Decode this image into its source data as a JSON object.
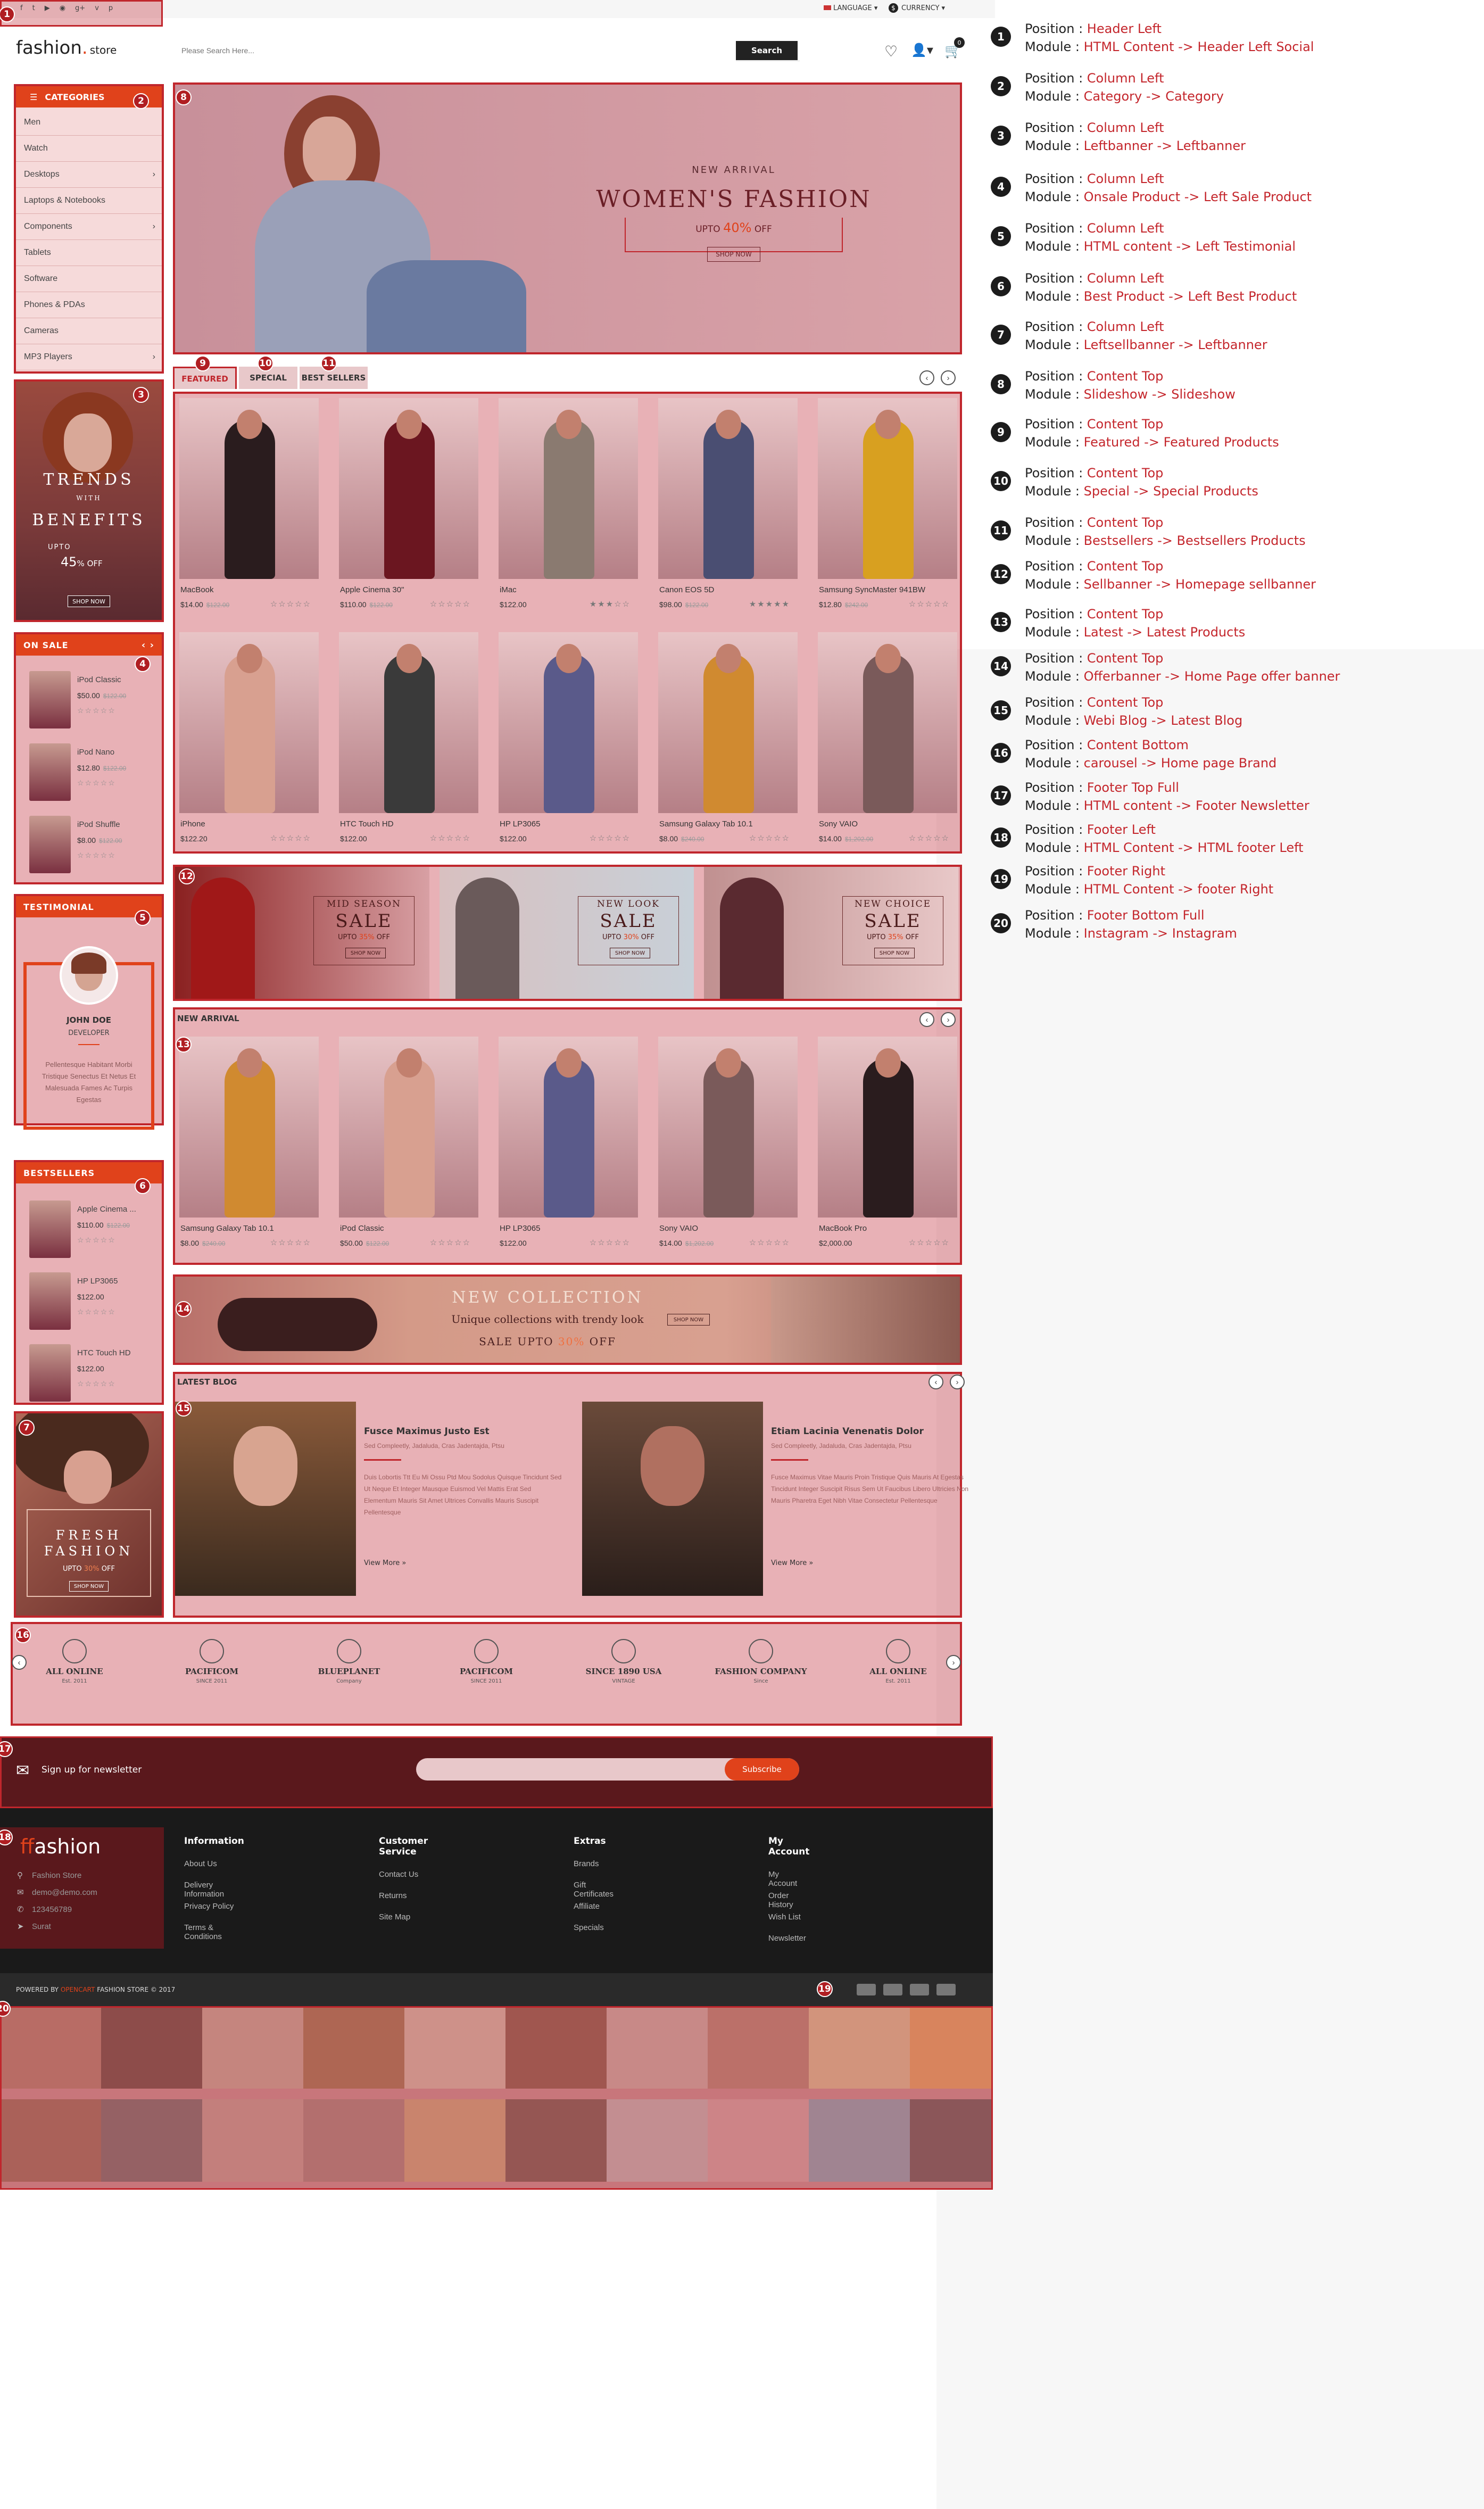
{
  "topbar": {
    "language": "LANGUAGE ▾",
    "currency": "CURRENCY ▾",
    "social_icons": [
      "facebook-icon",
      "twitter-icon",
      "youtube-icon",
      "rss-icon",
      "google-plus-icon",
      "vimeo-icon",
      "pinterest-icon"
    ]
  },
  "header": {
    "logo_main": "fashion",
    "logo_store": "store",
    "search_placeholder": "Please Search Here...",
    "search_button": "Search",
    "cart_count": "0"
  },
  "categories": {
    "title": "CATEGORIES",
    "items": [
      {
        "label": "Men",
        "arrow": ""
      },
      {
        "label": "Watch",
        "arrow": ""
      },
      {
        "label": "Desktops",
        "arrow": "›"
      },
      {
        "label": "Laptops & Notebooks",
        "arrow": ""
      },
      {
        "label": "Components",
        "arrow": "›"
      },
      {
        "label": "Tablets",
        "arrow": ""
      },
      {
        "label": "Software",
        "arrow": ""
      },
      {
        "label": "Phones & PDAs",
        "arrow": ""
      },
      {
        "label": "Cameras",
        "arrow": ""
      },
      {
        "label": "MP3 Players",
        "arrow": "›"
      }
    ]
  },
  "left_banner": {
    "line1": "TRENDS",
    "with": "WITH",
    "line2": "BENEFITS",
    "upto": "UPTO",
    "pct": "45",
    "off": "% OFF",
    "btn": "SHOP NOW"
  },
  "on_sale": {
    "title": "ON SALE",
    "items": [
      {
        "name": "iPod Classic",
        "price": "$50.00",
        "old": "$122.00",
        "stars": "☆☆☆☆☆"
      },
      {
        "name": "iPod Nano",
        "price": "$12.80",
        "old": "$122.00",
        "stars": "☆☆☆☆☆"
      },
      {
        "name": "iPod Shuffle",
        "price": "$8.00",
        "old": "$122.00",
        "stars": "☆☆☆☆☆"
      }
    ]
  },
  "testimonial": {
    "title": "TESTIMONIAL",
    "name": "JOHN DOE",
    "role": "DEVELOPER",
    "text": "Pellentesque Habitant Morbi Tristique Senectus Et Netus Et Malesuada Fames Ac Turpis Egestas"
  },
  "bestsellers_side": {
    "title": "BESTSELLERS",
    "items": [
      {
        "name": "Apple Cinema ...",
        "price": "$110.00",
        "old": "$122.00",
        "stars": "☆☆☆☆☆"
      },
      {
        "name": "HP LP3065",
        "price": "$122.00",
        "old": "",
        "stars": "☆☆☆☆☆"
      },
      {
        "name": "HTC Touch HD",
        "price": "$122.00",
        "old": "",
        "stars": "☆☆☆☆☆"
      }
    ]
  },
  "left_banner2": {
    "line1": "FRESH",
    "line2": "FASHION",
    "upto": "UPTO",
    "pct": "30%",
    "off": "OFF",
    "btn": "SHOP NOW"
  },
  "slideshow": {
    "kicker": "NEW ARRIVAL",
    "title": "WOMEN'S FASHION",
    "upto": "UPTO",
    "pct": "40%",
    "off": "OFF",
    "btn": "SHOP NOW"
  },
  "tabs": [
    "FEATURED",
    "SPECIAL",
    "BEST SELLERS"
  ],
  "featured": [
    {
      "name": "MacBook",
      "price": "$14.00",
      "old": "$122.00",
      "stars": "☆☆☆☆☆",
      "color": "#2a1c1e"
    },
    {
      "name": "Apple Cinema 30\"",
      "price": "$110.00",
      "old": "$122.00",
      "stars": "☆☆☆☆☆",
      "color": "#6b1620"
    },
    {
      "name": "iMac",
      "price": "$122.00",
      "old": "",
      "stars": "★★★☆☆",
      "color": "#8a7a70"
    },
    {
      "name": "Canon EOS 5D",
      "price": "$98.00",
      "old": "$122.00",
      "stars": "★★★★★",
      "color": "#4a4e72"
    },
    {
      "name": "Samsung SyncMaster 941BW",
      "price": "$12.80",
      "old": "$242.00",
      "stars": "☆☆☆☆☆",
      "color": "#d8a020"
    },
    {
      "name": "iPhone",
      "price": "$122.20",
      "old": "",
      "stars": "☆☆☆☆☆",
      "color": "#d8a090"
    },
    {
      "name": "HTC Touch HD",
      "price": "$122.00",
      "old": "",
      "stars": "☆☆☆☆☆",
      "color": "#3a3a3a"
    },
    {
      "name": "HP LP3065",
      "price": "$122.00",
      "old": "",
      "stars": "☆☆☆☆☆",
      "color": "#5a5a8a"
    },
    {
      "name": "Samsung Galaxy Tab 10.1",
      "price": "$8.00",
      "old": "$240.00",
      "stars": "☆☆☆☆☆",
      "color": "#d08a30"
    },
    {
      "name": "Sony VAIO",
      "price": "$14.00",
      "old": "$1,202.00",
      "stars": "☆☆☆☆☆",
      "color": "#7a5a5a"
    }
  ],
  "sell_banners": [
    {
      "line1": "MID SEASON",
      "line2": "SALE",
      "upto": "UPTO",
      "pct": "35%",
      "off": "OFF",
      "btn": "SHOP NOW"
    },
    {
      "line1": "NEW LOOK",
      "line2": "SALE",
      "upto": "UPTO",
      "pct": "30%",
      "off": "OFF",
      "btn": "SHOP NOW"
    },
    {
      "line1": "NEW CHOICE",
      "line2": "SALE",
      "upto": "UPTO",
      "pct": "35%",
      "off": "OFF",
      "btn": "SHOP NOW"
    }
  ],
  "new_arrival": {
    "title": "NEW ARRIVAL",
    "items": [
      {
        "name": "Samsung Galaxy Tab 10.1",
        "price": "$8.00",
        "old": "$240.00",
        "stars": "☆☆☆☆☆",
        "color": "#d08a30"
      },
      {
        "name": "iPod Classic",
        "price": "$50.00",
        "old": "$122.00",
        "stars": "☆☆☆☆☆",
        "color": "#d8a090"
      },
      {
        "name": "HP LP3065",
        "price": "$122.00",
        "old": "",
        "stars": "☆☆☆☆☆",
        "color": "#5a5a8a"
      },
      {
        "name": "Sony VAIO",
        "price": "$14.00",
        "old": "$1,202.00",
        "stars": "☆☆☆☆☆",
        "color": "#7a5a5a"
      },
      {
        "name": "MacBook Pro",
        "price": "$2,000.00",
        "old": "",
        "stars": "☆☆☆☆☆",
        "color": "#2a1c1e"
      }
    ]
  },
  "offer_banner": {
    "title": "NEW COLLECTION",
    "sub": "Unique collections with trendy look",
    "sale": "SALE UPTO",
    "pct": "30%",
    "off": "OFF",
    "btn": "SHOP NOW"
  },
  "blog": {
    "title": "LATEST BLOG",
    "posts": [
      {
        "title": "Fusce Maximus Justo Est",
        "meta": "Sed Compleetly, Jadaluda, Cras Jadentajda, Ptsu",
        "text": "Duis Lobortis Ttt Eu Mi Ossu Ptd Mou Sodolus Quisque Tincidunt Sed Ut Neque Et Integer Mausque Euismod Vel Mattis Erat Sed Elementum Mauris Sit Amet Ultrices Convallis Mauris Suscipit Pellentesque",
        "more": "View More »"
      },
      {
        "title": "Etiam Lacinia Venenatis Dolor",
        "meta": "Sed Compleetly, Jadaluda, Cras Jadentajda, Ptsu",
        "text": "Fusce Maximus Vitae Mauris Proin Tristique Quis Mauris At Egestas Tincidunt Integer Suscipit Risus Sem Ut Faucibus Libero Ultricies Non Mauris Pharetra Eget Nibh Vitae Consectetur Pellentesque",
        "more": "View More »"
      }
    ]
  },
  "brands": [
    {
      "name": "ALL ONLINE",
      "sub": "Est. 2011"
    },
    {
      "name": "PACIFICOM",
      "sub": "SINCE 2011"
    },
    {
      "name": "BLUEPLANET",
      "sub": "Company"
    },
    {
      "name": "PACIFICOM",
      "sub": "SINCE 2011"
    },
    {
      "name": "SINCE 1890 USA",
      "sub": "VINTAGE"
    },
    {
      "name": "FASHION COMPANY",
      "sub": "Since"
    },
    {
      "name": "ALL ONLINE",
      "sub": "Est. 2011"
    }
  ],
  "newsletter": {
    "label": "Sign up for newsletter",
    "button": "Subscribe"
  },
  "footer": {
    "logo": "fashion",
    "contact": [
      "Fashion Store",
      "demo@demo.com",
      "123456789",
      "Surat"
    ],
    "columns": [
      {
        "title": "Information",
        "items": [
          "About Us",
          "Delivery Information",
          "Privacy Policy",
          "Terms & Conditions"
        ]
      },
      {
        "title": "Customer Service",
        "items": [
          "Contact Us",
          "Returns",
          "Site Map"
        ]
      },
      {
        "title": "Extras",
        "items": [
          "Brands",
          "Gift Certificates",
          "Affiliate",
          "Specials"
        ]
      },
      {
        "title": "My Account",
        "items": [
          "My Account",
          "Order History",
          "Wish List",
          "Newsletter"
        ]
      }
    ],
    "powered_pre": "POWERED BY",
    "powered_brand": "OPENCART",
    "powered_post": "FASHION STORE © 2017"
  },
  "instagram_colors": [
    "#b07c6c",
    "#6e4a42",
    "#c4a292",
    "#a07250",
    "#d2b4a4",
    "#8a5a4a",
    "#c8a8a0",
    "#b48272",
    "#d8b890",
    "#e0a060",
    "#9a6a5a",
    "#7a6a6a",
    "#c09890",
    "#a8807a",
    "#caa078",
    "#7a5a50",
    "#c0b0b0",
    "#d0a0a0",
    "#8aa0b0",
    "#6a5a5a"
  ],
  "legend": [
    {
      "n": "1",
      "pos": "Header Left",
      "mod": "HTML Content -> Header Left Social"
    },
    {
      "n": "2",
      "pos": "Column  Left",
      "mod": "Category  -> Category"
    },
    {
      "n": "3",
      "pos": "Column  Left",
      "mod": "Leftbanner -> Leftbanner"
    },
    {
      "n": "4",
      "pos": "Column  Left",
      "mod": "Onsale Product -> Left Sale Product"
    },
    {
      "n": "5",
      "pos": "Column  Left",
      "mod": "HTML content -> Left Testimonial"
    },
    {
      "n": "6",
      "pos": "Column  Left",
      "mod": "Best Product -> Left Best Product"
    },
    {
      "n": "7",
      "pos": "Column  Left",
      "mod": "Leftsellbanner -> Leftbanner"
    },
    {
      "n": "8",
      "pos": "Content Top",
      "mod": "Slideshow -> Slideshow"
    },
    {
      "n": "9",
      "pos": "Content Top",
      "mod": "Featured -> Featured Products"
    },
    {
      "n": "10",
      "pos": "Content Top",
      "mod": "Special ->  Special Products"
    },
    {
      "n": "11",
      "pos": "Content Top",
      "mod": "Bestsellers -> Bestsellers Products"
    },
    {
      "n": "12",
      "pos": "Content Top",
      "mod": "Sellbanner -> Homepage  sellbanner"
    },
    {
      "n": "13",
      "pos": "Content Top",
      "mod": "Latest -> Latest Products"
    },
    {
      "n": "14",
      "pos": "Content Top",
      "mod": "Offerbanner -> Home Page offer banner"
    },
    {
      "n": "15",
      "pos": "Content Top",
      "mod": "Webi Blog -> Latest Blog"
    },
    {
      "n": "16",
      "pos": "Content Bottom",
      "mod": "carousel -> Home page Brand"
    },
    {
      "n": "17",
      "pos": "Footer Top Full",
      "mod": "HTML content -> Footer Newsletter"
    },
    {
      "n": "18",
      "pos": "Footer Left",
      "mod": " HTML Content  -> HTML footer Left"
    },
    {
      "n": "19",
      "pos": "Footer Right",
      "mod": " HTML Content  -> footer Right"
    },
    {
      "n": "20",
      "pos": "Footer Bottom Full",
      "mod": " Instagram -> Instagram"
    }
  ],
  "legend_labels": {
    "position": "Position : ",
    "module": "Module  : "
  }
}
